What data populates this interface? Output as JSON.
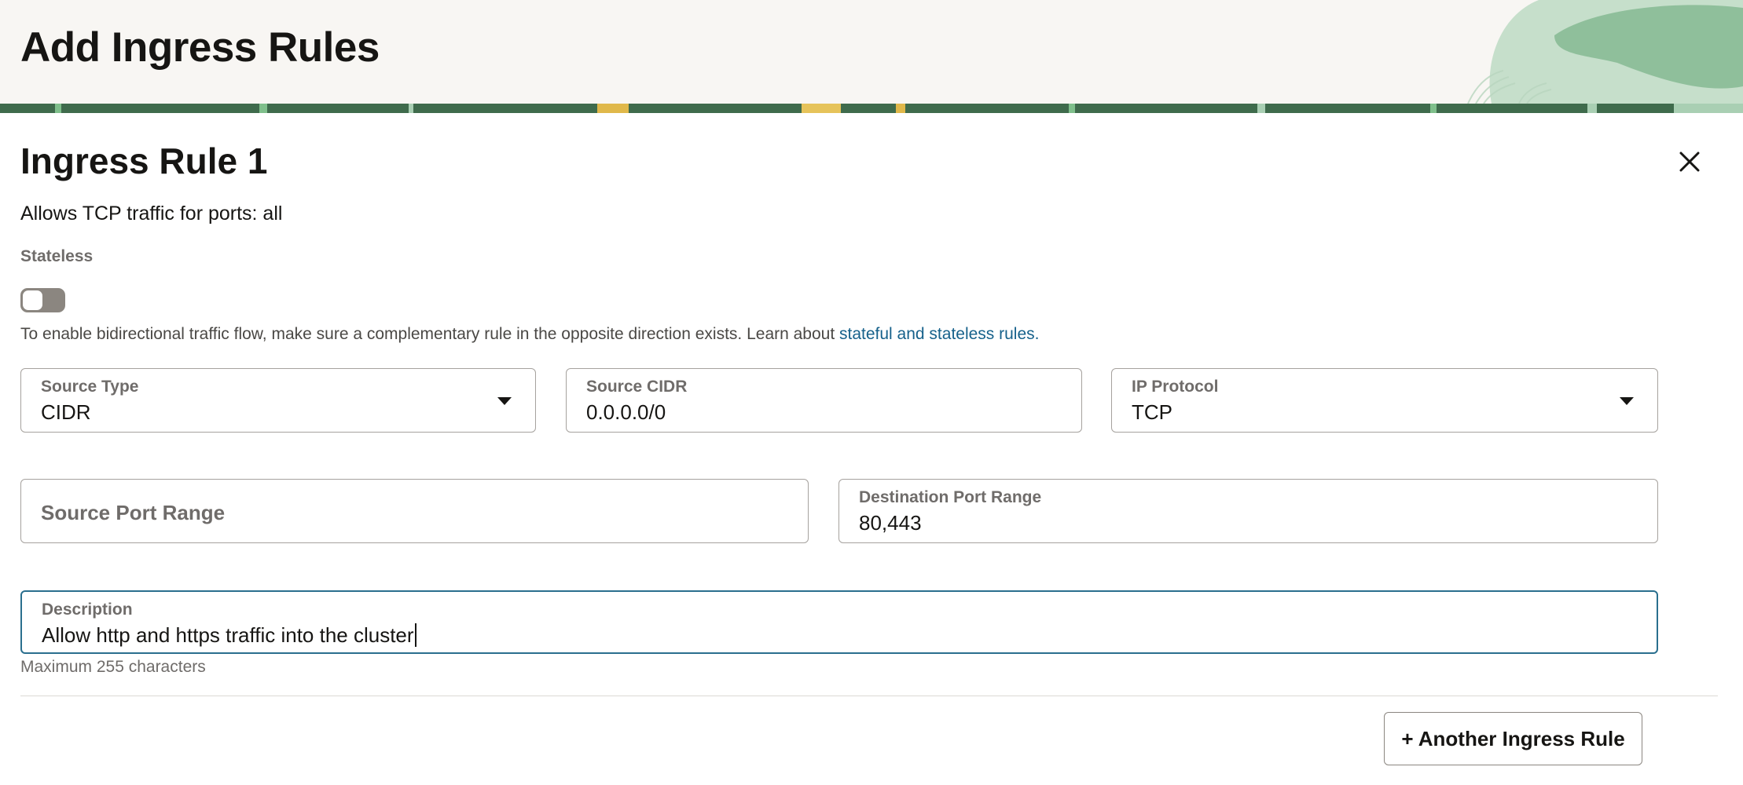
{
  "page": {
    "title": "Add Ingress Rules"
  },
  "rule": {
    "title": "Ingress Rule 1",
    "summary": "Allows TCP traffic for ports: all",
    "stateless": {
      "label": "Stateless",
      "enabled": false
    },
    "help_text": "To enable bidirectional traffic flow, make sure a complementary rule in the opposite direction exists. Learn about ",
    "help_link": "stateful and stateless rules."
  },
  "fields": {
    "source_type": {
      "label": "Source Type",
      "value": "CIDR"
    },
    "source_cidr": {
      "label": "Source CIDR",
      "value": "0.0.0.0/0"
    },
    "ip_protocol": {
      "label": "IP Protocol",
      "value": "TCP"
    },
    "source_port_range": {
      "placeholder": "Source Port Range",
      "value": ""
    },
    "destination_port_range": {
      "label": "Destination Port Range",
      "value": "80,443"
    },
    "description": {
      "label": "Description",
      "value": "Allow http and https traffic into the cluster",
      "hint": "Maximum 255 characters"
    }
  },
  "actions": {
    "add_rule_label": "+ Another Ingress Rule"
  },
  "colors": {
    "focus_border": "#2a6f8e",
    "link": "#16618b",
    "header_background": "#f8f6f3",
    "header_art_green": "#a9cfb3",
    "toggle_off": "#8b8680"
  },
  "icons": {
    "close": "close-icon",
    "dropdown": "chevron-down-icon"
  }
}
